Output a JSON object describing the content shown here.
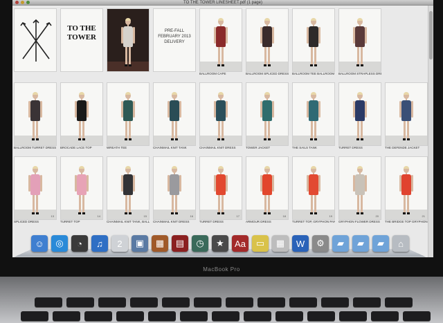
{
  "window": {
    "title": "TO THE TOWER LINESHEET.pdf (1 page)"
  },
  "brand": {
    "heading": "TO THE TOWER",
    "season": "PRE-FALL FEBRUARY 2013 DELIVERY"
  },
  "laptop": {
    "label": "MacBook Pro"
  },
  "cards": [
    {
      "kind": "logo",
      "caption": ""
    },
    {
      "kind": "title",
      "caption": ""
    },
    {
      "kind": "photo",
      "caption": ""
    },
    {
      "kind": "delivery",
      "caption": ""
    },
    {
      "kind": "look",
      "caption": "BALLROOM CAPE",
      "color": "#8a2a2a",
      "page": ""
    },
    {
      "kind": "look",
      "caption": "BALLROOM SPLICED DRESS",
      "color": "#3a2b2b",
      "page": ""
    },
    {
      "kind": "look",
      "caption": "BALLROOM TEE BALLROOM SKIRT",
      "color": "#2e2a2a",
      "page": ""
    },
    {
      "kind": "look",
      "caption": "BALLROOM STRAPLESS DRESS",
      "color": "#5a3a3a",
      "page": ""
    },
    {
      "kind": "empty",
      "caption": ""
    },
    {
      "kind": "look",
      "caption": "BALLROOM TURRET DRESS",
      "color": "#3a3336",
      "page": ""
    },
    {
      "kind": "look",
      "caption": "BROCADE LACE TOP",
      "color": "#1a1a1a",
      "page": ""
    },
    {
      "kind": "look",
      "caption": "WREATH TEE",
      "color": "#2f5a55",
      "page": ""
    },
    {
      "kind": "look",
      "caption": "CHAINMAIL KNIT TANK",
      "color": "#2a4d56",
      "page": ""
    },
    {
      "kind": "look",
      "caption": "CHAINMAIL KNIT DRESS",
      "color": "#2b4f5a",
      "page": ""
    },
    {
      "kind": "look",
      "caption": "TOWER JACKET",
      "color": "#2f6d6d",
      "page": ""
    },
    {
      "kind": "look",
      "caption": "THE SAILS TANK",
      "color": "#2f6a74",
      "page": ""
    },
    {
      "kind": "look",
      "caption": "TURRET DRESS",
      "color": "#2b3a66",
      "page": ""
    },
    {
      "kind": "look",
      "caption": "THE DEFENDE JACKET",
      "color": "#3b4f76",
      "page": ""
    },
    {
      "kind": "look",
      "caption": "SPLICED DRESS",
      "color": "#e3a0b8",
      "page": "13"
    },
    {
      "kind": "look",
      "caption": "TURRET TOP",
      "color": "#e7a3b6",
      "page": "14"
    },
    {
      "kind": "look",
      "caption": "CHAINMAIL KNIT TANK, BALLROOM MINI",
      "color": "#333336",
      "page": "15"
    },
    {
      "kind": "look",
      "caption": "CHAINMAIL KNIT DRESS",
      "color": "#9a9a9e",
      "page": "16"
    },
    {
      "kind": "look",
      "caption": "TURRET DRESS",
      "color": "#e2482f",
      "page": "17"
    },
    {
      "kind": "look",
      "caption": "ARMOUR DRESS",
      "color": "#e2462c",
      "page": "18"
    },
    {
      "kind": "look",
      "caption": "TURRET TOP, GRYPHON PANTS",
      "color": "#e24a32",
      "page": "19"
    },
    {
      "kind": "look",
      "caption": "GRYPHON FLOWER DRESS",
      "color": "#c9c2b8",
      "page": "20"
    },
    {
      "kind": "look",
      "caption": "THE BRIDGE TOP GRYPHON SKIRT",
      "color": "#e0432f",
      "page": "21"
    }
  ],
  "dock": {
    "items": [
      {
        "name": "finder-icon",
        "glyph": "☺",
        "color": "#3f7fd0"
      },
      {
        "name": "safari-icon",
        "glyph": "◎",
        "color": "#2a8ad8"
      },
      {
        "name": "dashboard-icon",
        "glyph": "◔",
        "color": "#3a3a3a"
      },
      {
        "name": "itunes-icon",
        "glyph": "♫",
        "color": "#2f6fc4"
      },
      {
        "name": "calendar-icon",
        "glyph": "2",
        "color": "#cfd2d6"
      },
      {
        "name": "iphoto-icon",
        "glyph": "▣",
        "color": "#5a7aa3"
      },
      {
        "name": "preview-icon",
        "glyph": "▦",
        "color": "#a05a2a"
      },
      {
        "name": "photo-booth-icon",
        "glyph": "▤",
        "color": "#8b2020"
      },
      {
        "name": "time-machine-icon",
        "glyph": "◷",
        "color": "#3a6a5a"
      },
      {
        "name": "imovie-icon",
        "glyph": "★",
        "color": "#4a4a4a"
      },
      {
        "name": "dictionary-icon",
        "glyph": "Aa",
        "color": "#a32a2a"
      },
      {
        "name": "stickies-icon",
        "glyph": "▭",
        "color": "#d9c24a"
      },
      {
        "name": "calculator-icon",
        "glyph": "▦",
        "color": "#bdbdbd"
      },
      {
        "name": "word-icon",
        "glyph": "W",
        "color": "#2a62b8"
      },
      {
        "name": "system-preferences-icon",
        "glyph": "⚙",
        "color": "#8a8a8a"
      },
      {
        "name": "applications-folder-icon",
        "glyph": "▰",
        "color": "#6fa3d8"
      },
      {
        "name": "documents-folder-icon",
        "glyph": "▰",
        "color": "#6fa3d8"
      },
      {
        "name": "downloads-folder-icon",
        "glyph": "▰",
        "color": "#6fa3d8"
      },
      {
        "name": "trash-icon",
        "glyph": "⌂",
        "color": "#b7bcc2"
      }
    ]
  }
}
